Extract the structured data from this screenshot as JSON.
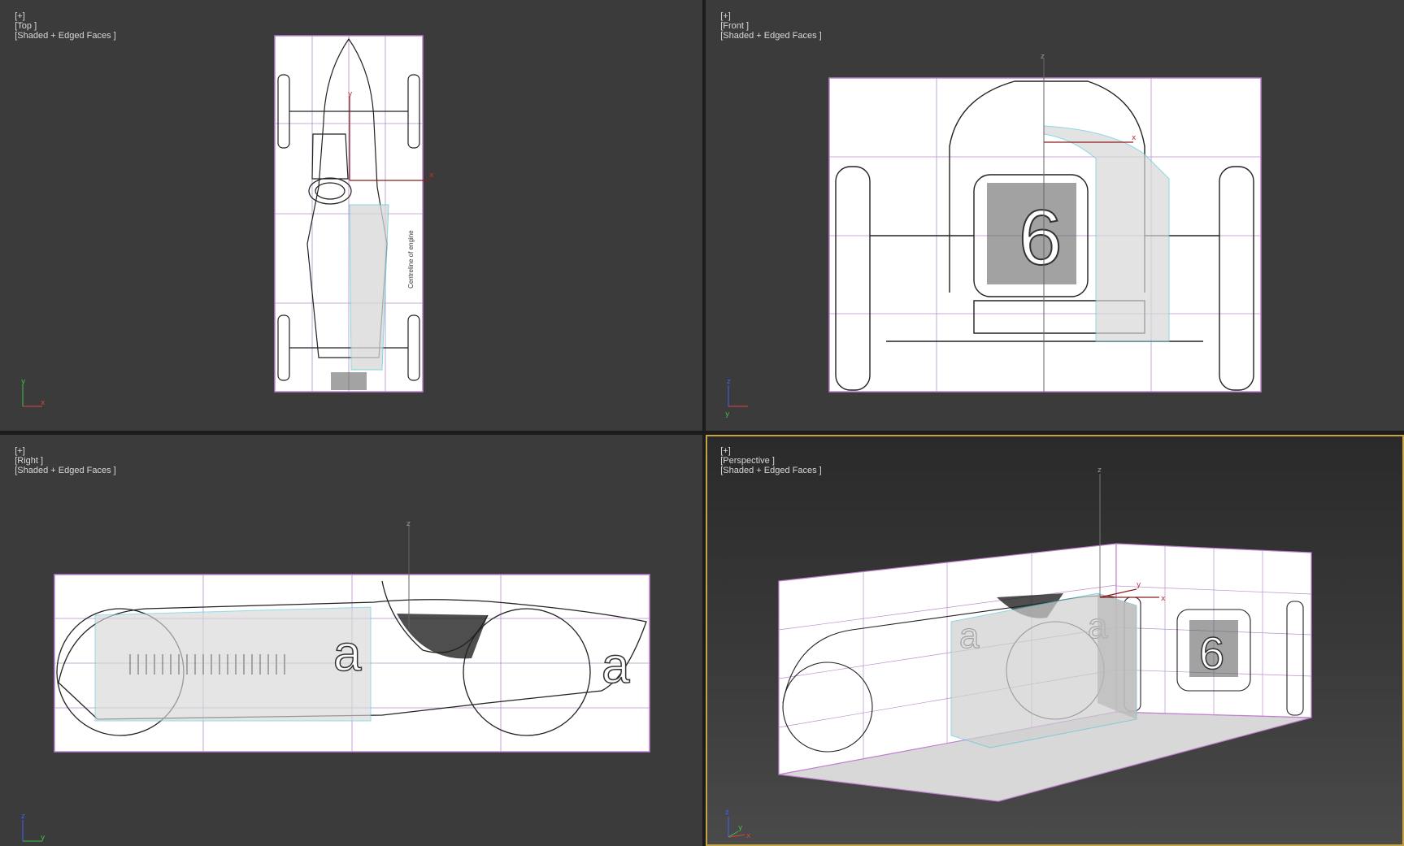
{
  "viewports": {
    "top": {
      "bracket": "[+]",
      "view": "[Top ]",
      "shading": "[Shaded + Edged Faces ]"
    },
    "front": {
      "bracket": "[+]",
      "view": "[Front ]",
      "shading": "[Shaded + Edged Faces ]"
    },
    "right": {
      "bracket": "[+]",
      "view": "[Right ]",
      "shading": "[Shaded + Edged Faces ]"
    },
    "perspective": {
      "bracket": "[+]",
      "view": "[Perspective ]",
      "shading": "[Shaded + Edged Faces ]",
      "active": true
    }
  },
  "axis_labels": {
    "x": "x",
    "y": "y",
    "z": "z"
  },
  "blueprint_text": {
    "car_number": "a",
    "grille_number": "6",
    "engine_note": "Centreline of engine"
  },
  "colors": {
    "viewport_bg": "#3b3b3b",
    "active_border": "#c8a440",
    "edge_color": "#c080d0",
    "axis_x": "#e04040",
    "axis_y": "#40c040",
    "axis_z": "#4060ff"
  }
}
